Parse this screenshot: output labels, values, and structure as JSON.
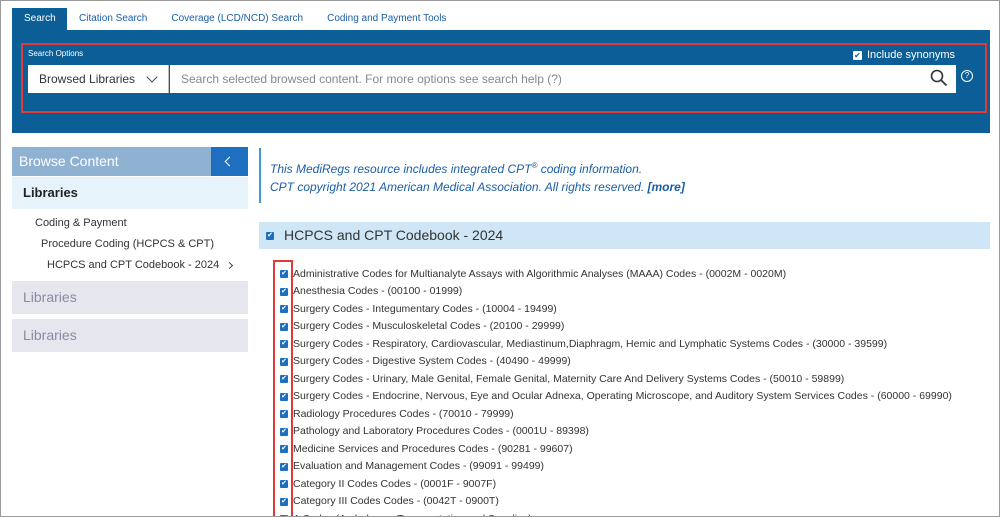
{
  "tabs": [
    "Search",
    "Citation Search",
    "Coverage (LCD/NCD) Search",
    "Coding and Payment Tools"
  ],
  "search": {
    "options_label": "Search Options",
    "include_synonyms_label": "Include synonyms",
    "include_synonyms_checked": true,
    "library_selected": "Browsed Libraries",
    "placeholder": "Search selected browsed content. For more options see search help (?)",
    "help_glyph": "?"
  },
  "sidebar": {
    "header": "Browse Content",
    "active_library": "Libraries",
    "tree": [
      "Coding & Payment",
      "Procedure Coding (HCPCS & CPT)",
      "HCPCS and CPT Codebook - 2024"
    ],
    "other_libraries": [
      "Libraries",
      "Libraries"
    ]
  },
  "notice": {
    "line1_prefix": "This MediRegs resource includes integrated CPT",
    "line1_sup": "®",
    "line1_suffix": " coding information.",
    "line2": "CPT copyright 2021 American Medical Association. All rights reserved. ",
    "more": "[more]"
  },
  "book": {
    "title": "HCPCS and CPT Codebook - 2024",
    "checked": true,
    "items": [
      "Administrative Codes for Multianalyte Assays with Algorithmic Analyses (MAAA) Codes - (0002M - 0020M)",
      "Anesthesia Codes - (00100 - 01999)",
      "Surgery Codes - Integumentary Codes - (10004 - 19499)",
      "Surgery Codes - Musculoskeletal Codes - (20100 - 29999)",
      "Surgery Codes - Respiratory, Cardiovascular, Mediastinum,Diaphragm, Hemic and Lymphatic Systems Codes - (30000 - 39599)",
      "Surgery Codes - Digestive System Codes - (40490 - 49999)",
      "Surgery Codes - Urinary, Male Genital, Female Genital, Maternity Care And Delivery Systems Codes - (50010 - 59899)",
      "Surgery Codes - Endocrine, Nervous, Eye and Ocular Adnexa, Operating Microscope, and Auditory System Services Codes - (60000 - 69990)",
      "Radiology Procedures Codes - (70010 - 79999)",
      "Pathology and Laboratory Procedures Codes - (0001U - 89398)",
      "Medicine Services and Procedures Codes - (90281 - 99607)",
      "Evaluation and Management Codes - (99091 - 99499)",
      "Category II Codes Codes - (0001F - 9007F)",
      "Category III Codes Codes - (0042T - 0900T)",
      "A Codes (Ambulance, Transportation and Supplies)"
    ]
  },
  "colors": {
    "header_blue": "#0b5f96",
    "accent_blue": "#1f6fc0",
    "highlight_red": "#e03a3a"
  }
}
